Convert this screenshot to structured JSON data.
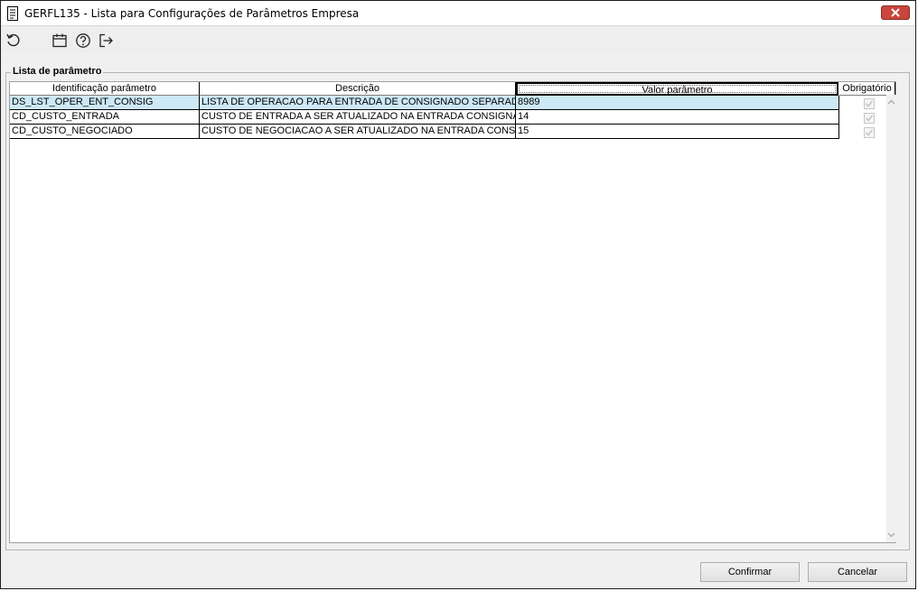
{
  "window": {
    "title": "GERFL135 - Lista para Configurações de Parâmetros Empresa"
  },
  "toolbar": {
    "icons": [
      "refresh-icon",
      "calendar-icon",
      "help-icon",
      "exit-icon"
    ]
  },
  "group": {
    "label": "Lista de parâmetro"
  },
  "grid": {
    "columns": [
      "Identificação parâmetro",
      "Descrição",
      "Valor parâmetro",
      "Obrigatório"
    ],
    "rows": [
      {
        "id": "DS_LST_OPER_ENT_CONSIG",
        "descricao": "LISTA DE OPERACAO PARA ENTRADA DE CONSIGNADO SEPARADA POR VIRGULA",
        "valor": "8989",
        "obrigatorio": true,
        "selected": true
      },
      {
        "id": "CD_CUSTO_ENTRADA",
        "descricao": "CUSTO DE ENTRADA A SER ATUALIZADO NA ENTRADA CONSIGNACAO",
        "valor": "14",
        "obrigatorio": true,
        "selected": false
      },
      {
        "id": "CD_CUSTO_NEGOCIADO",
        "descricao": "CUSTO DE NEGOCIACAO A SER ATUALIZADO NA ENTRADA CONSIGNACAO",
        "valor": "15",
        "obrigatorio": true,
        "selected": false
      }
    ]
  },
  "buttons": {
    "confirm": "Confirmar",
    "cancel": "Cancelar"
  },
  "colors": {
    "selected_row": "#cde8f7",
    "close_button": "#c9463d"
  }
}
